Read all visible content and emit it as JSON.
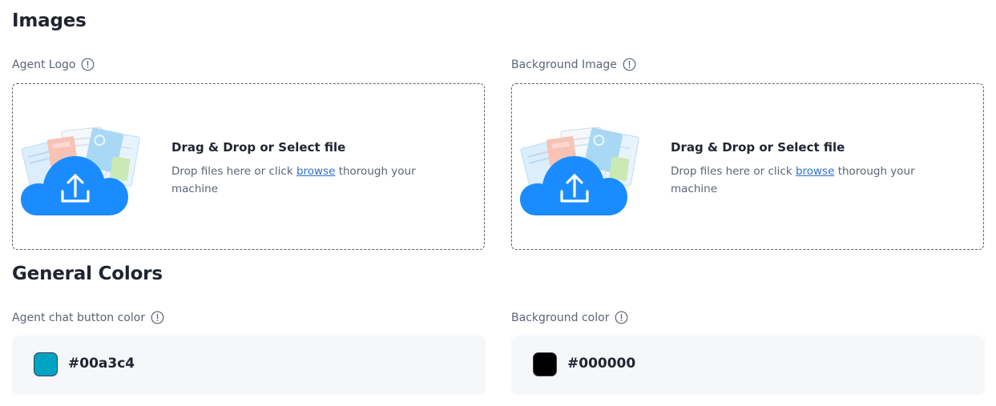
{
  "sections": {
    "images_title": "Images",
    "colors_title": "General Colors"
  },
  "images": {
    "agent_logo": {
      "label": "Agent Logo",
      "drop_title": "Drag & Drop or Select file",
      "drop_text_before": "Drop files here or click ",
      "browse_link": "browse",
      "drop_text_after": " thorough your machine",
      "icon": "cloud-upload-icon"
    },
    "background_image": {
      "label": "Background Image",
      "drop_title": "Drag & Drop or Select file",
      "drop_text_before": "Drop files here or click ",
      "browse_link": "browse",
      "drop_text_after": " thorough your machine",
      "icon": "cloud-upload-icon"
    }
  },
  "colors": {
    "agent_chat_button": {
      "label": "Agent chat button color",
      "value": "#00a3c4",
      "swatch": "#00a3c4"
    },
    "background": {
      "label": "Background color",
      "value": "#000000",
      "swatch": "#000000"
    }
  },
  "theme": {
    "accent": "#1e90ff",
    "link": "#2f6fd0",
    "panel_bg": "#f6f7f9"
  }
}
